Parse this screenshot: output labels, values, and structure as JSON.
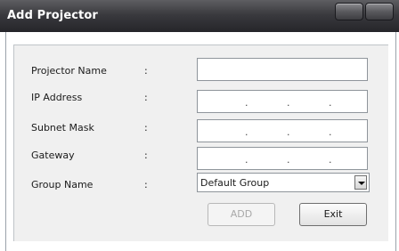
{
  "window": {
    "title": "Add Projector"
  },
  "form": {
    "projector_name": {
      "label": "Projector Name",
      "colon": ":",
      "value": ""
    },
    "ip_address": {
      "label": "IP Address",
      "colon": ":",
      "dots": [
        ".",
        ".",
        "."
      ]
    },
    "subnet_mask": {
      "label": "Subnet Mask",
      "colon": ":",
      "dots": [
        ".",
        ".",
        "."
      ]
    },
    "gateway": {
      "label": "Gateway",
      "colon": ":",
      "dots": [
        ".",
        ".",
        "."
      ]
    },
    "group_name": {
      "label": "Group Name",
      "colon": ":",
      "selected": "Default Group"
    }
  },
  "buttons": {
    "add": "ADD",
    "exit": "Exit"
  }
}
